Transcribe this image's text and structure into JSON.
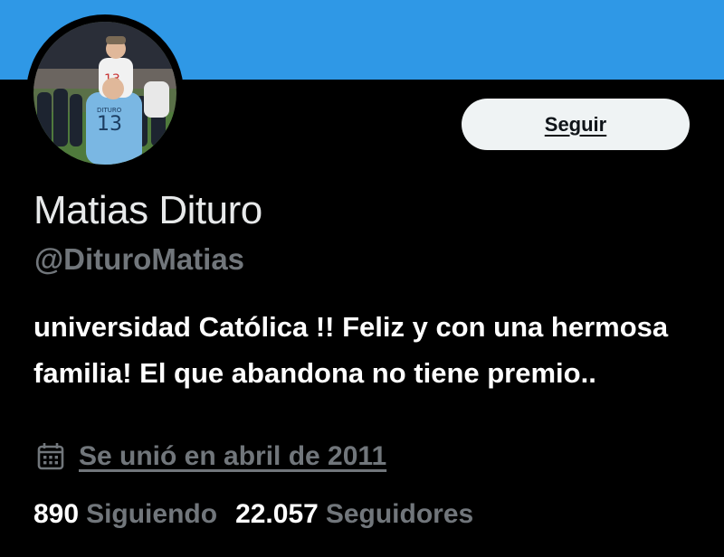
{
  "header": {
    "banner_color": "#2f98e6"
  },
  "profile": {
    "avatar": "avatar-photo-footballer",
    "name": "Matias Dituro",
    "handle": "@DituroMatias",
    "follow_label": "Seguir",
    "bio": "universidad Católica !! Feliz y con una hermosa familia! El que abandona no tiene premio..",
    "joined_icon": "calendar-icon",
    "joined": "Se unió en abril de 2011"
  },
  "stats": {
    "following_count": "890",
    "following_label": "Siguiendo",
    "followers_count": "22.057",
    "followers_label": "Seguidores"
  },
  "colors": {
    "background": "#000000",
    "muted_text": "#71767b",
    "button_bg": "#eff3f4"
  }
}
